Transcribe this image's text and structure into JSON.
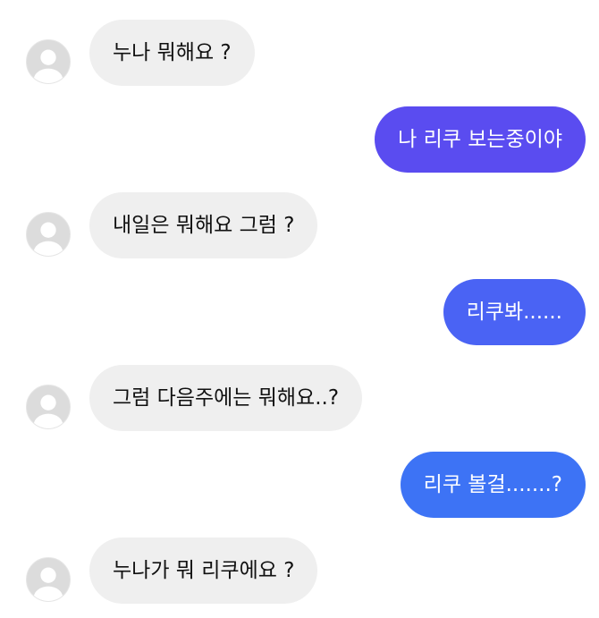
{
  "avatar_icon": "default-profile-icon",
  "colors": {
    "incoming_bubble": "#efefef",
    "incoming_text": "#111111",
    "outgoing_text": "#ffffff",
    "outgoing_bubble_1": "#5a4cf0",
    "outgoing_bubble_2": "#4a63f4",
    "outgoing_bubble_3": "#3d73f5"
  },
  "messages": [
    {
      "sender": "other",
      "text": "누나 뭐해요 ?"
    },
    {
      "sender": "me",
      "text": "나 리쿠 보는중이야"
    },
    {
      "sender": "other",
      "text": "내일은 뭐해요 그럼 ?"
    },
    {
      "sender": "me",
      "text": "리쿠봐......"
    },
    {
      "sender": "other",
      "text": "그럼 다음주에는 뭐해요..?"
    },
    {
      "sender": "me",
      "text": "리쿠 볼걸.......?"
    },
    {
      "sender": "other",
      "text": "누나가 뭐 리쿠에요 ?"
    }
  ]
}
